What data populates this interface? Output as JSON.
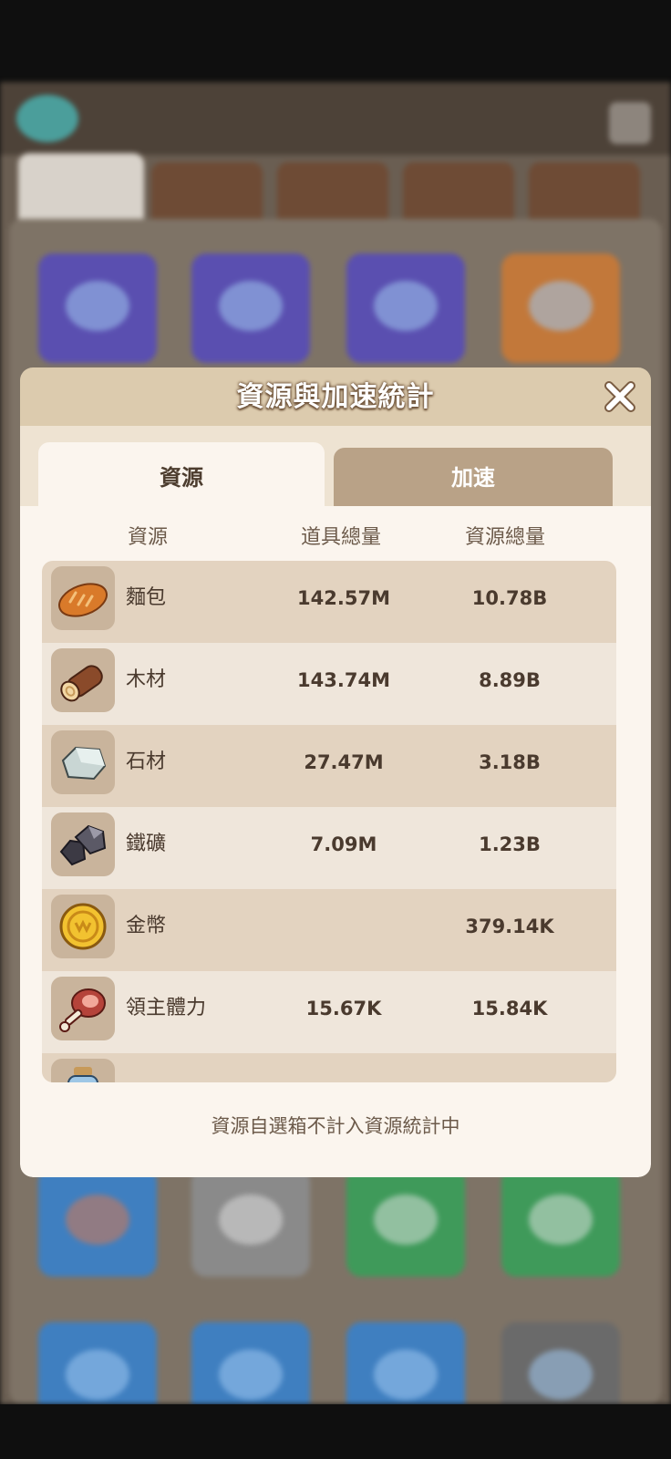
{
  "modal": {
    "title": "資源與加速統計",
    "tabs": [
      {
        "label": "資源",
        "active": true
      },
      {
        "label": "加速",
        "active": false
      }
    ],
    "columns": [
      "資源",
      "道具總量",
      "資源總量"
    ],
    "rows": [
      {
        "icon": "bread-icon",
        "name": "麵包",
        "item_total": "142.57M",
        "resource_total": "10.78B"
      },
      {
        "icon": "wood-log-icon",
        "name": "木材",
        "item_total": "143.74M",
        "resource_total": "8.89B"
      },
      {
        "icon": "stone-icon",
        "name": "石材",
        "item_total": "27.47M",
        "resource_total": "3.18B"
      },
      {
        "icon": "iron-ore-icon",
        "name": "鐵礦",
        "item_total": "7.09M",
        "resource_total": "1.23B"
      },
      {
        "icon": "gold-coin-icon",
        "name": "金幣",
        "item_total": "",
        "resource_total": "379.14K"
      },
      {
        "icon": "meat-icon",
        "name": "領主體力",
        "item_total": "15.67K",
        "resource_total": "15.84K"
      }
    ],
    "footer_note": "資源自選箱不計入資源統計中"
  },
  "colors": {
    "header_bg": "#dccbae",
    "active_tab_bg": "#fbf5ee",
    "inactive_tab_bg": "#b9a287",
    "row_odd_bg": "#e3d3c0",
    "row_even_bg": "#efe6db",
    "text_dark": "#4a3a2e"
  }
}
